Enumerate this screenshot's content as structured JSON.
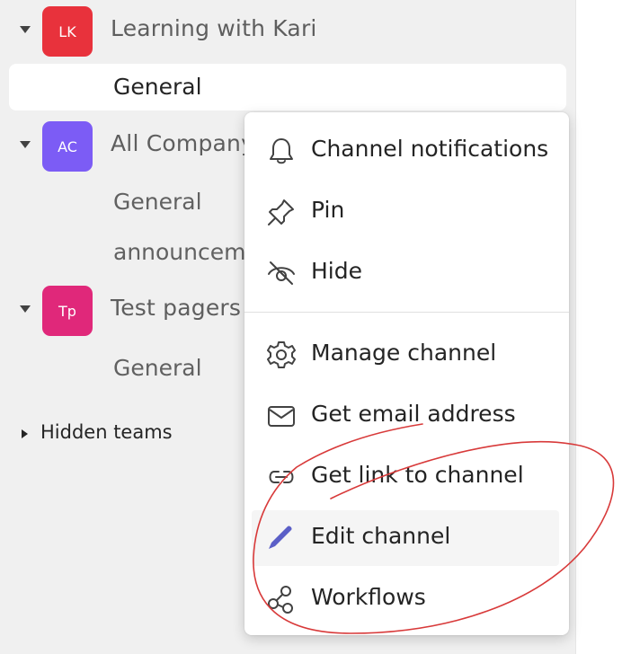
{
  "teams": [
    {
      "initials": "LK",
      "name": "Learning with Kari",
      "color": "#e8323c"
    },
    {
      "initials": "AC",
      "name": "All Company",
      "color": "#7c5cf5"
    },
    {
      "initials": "Tp",
      "name": "Test pagers",
      "color": "#e0287a"
    }
  ],
  "channels": {
    "selected": "General",
    "all_company_general": "General",
    "all_company_announcements": "announcements",
    "test_pagers_general": "General"
  },
  "hidden_teams_label": "Hidden teams",
  "menu": {
    "items": [
      {
        "label": "Channel notifications",
        "icon": "bell-icon"
      },
      {
        "label": "Pin",
        "icon": "pin-icon"
      },
      {
        "label": "Hide",
        "icon": "eye-off-icon"
      },
      {
        "label": "Manage channel",
        "icon": "gear-icon"
      },
      {
        "label": "Get email address",
        "icon": "mail-icon"
      },
      {
        "label": "Get link to channel",
        "icon": "link-icon"
      },
      {
        "label": "Edit channel",
        "icon": "pencil-icon"
      },
      {
        "label": "Workflows",
        "icon": "workflow-icon"
      }
    ]
  },
  "colors": {
    "accent": "#5b5fc7",
    "annotation": "#d83a3a"
  }
}
